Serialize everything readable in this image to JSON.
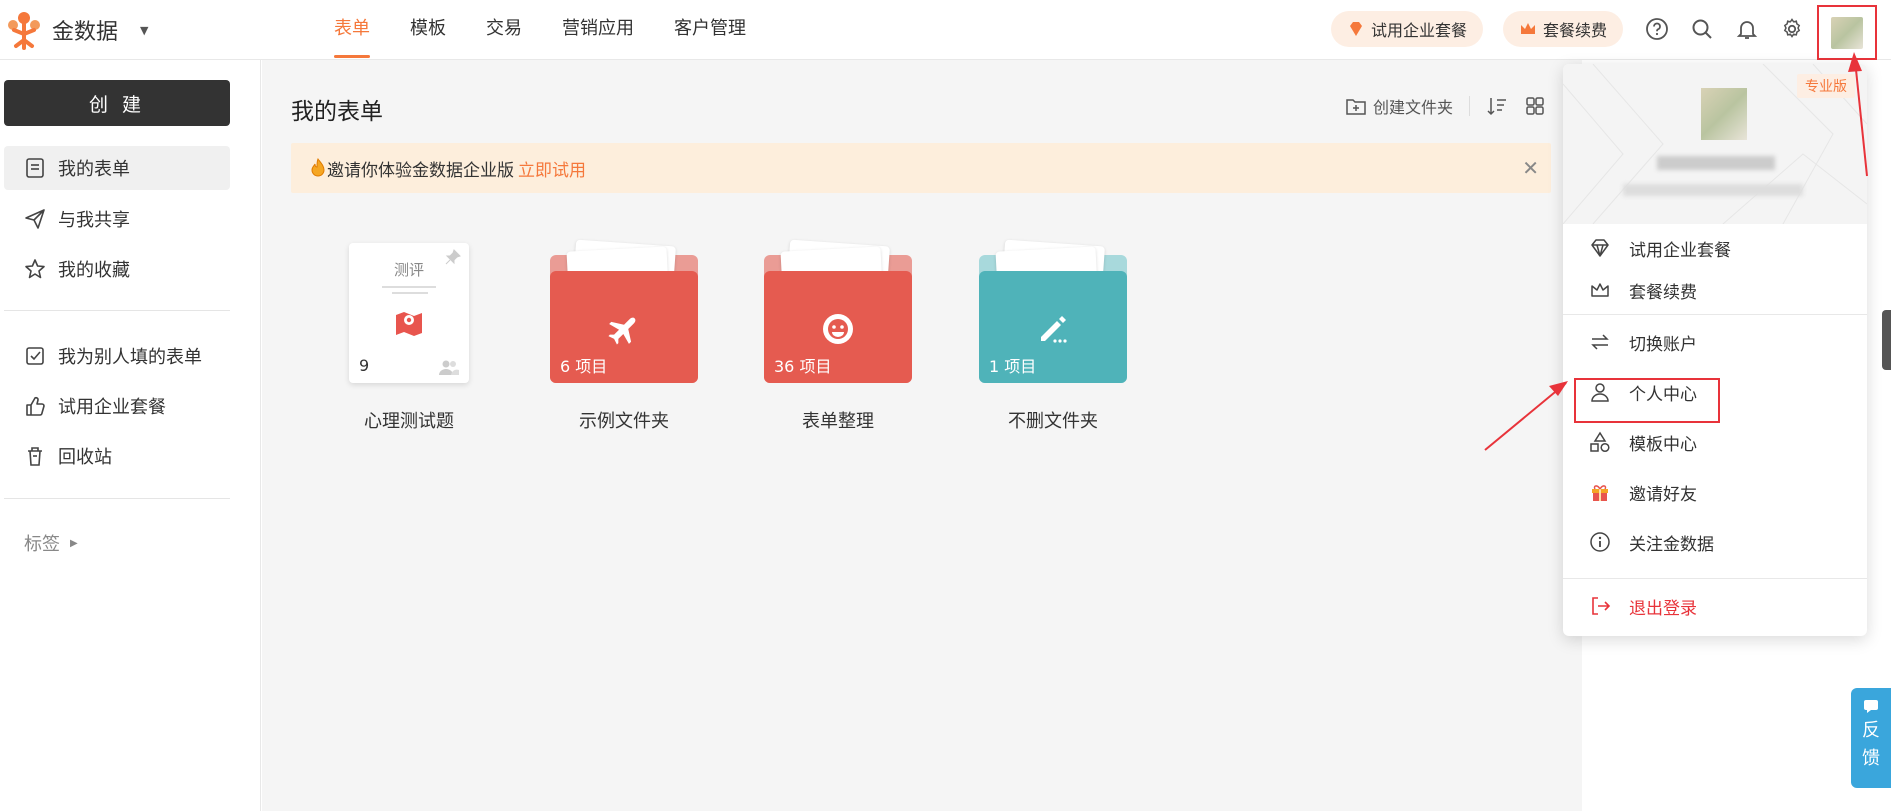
{
  "app": {
    "name": "金数据"
  },
  "nav": {
    "items": [
      "表单",
      "模板",
      "交易",
      "营销应用",
      "客户管理"
    ],
    "active": 0
  },
  "header": {
    "trial_label": "试用企业套餐",
    "renew_label": "套餐续费"
  },
  "sidebar": {
    "create_label": "创 建",
    "items": [
      "我的表单",
      "与我共享",
      "我的收藏",
      "我为别人填的表单",
      "试用企业套餐",
      "回收站"
    ],
    "tag_label": "标签"
  },
  "main": {
    "title": "我的表单",
    "new_folder_label": "创建文件夹",
    "banner_text": "邀请你体验金数据企业版",
    "banner_link": "立即试用",
    "form_card": {
      "title": "测评",
      "count": "9",
      "label": "心理测试题"
    },
    "folders": [
      {
        "count": "6 项目",
        "label": "示例文件夹",
        "color": "#e55b50",
        "icon": "plane-icon"
      },
      {
        "count": "36 项目",
        "label": "表单整理",
        "color": "#e55b50",
        "icon": "smile-icon"
      },
      {
        "count": "1 项目",
        "label": "不删文件夹",
        "color": "#4fb3b9",
        "icon": "pen-icon"
      }
    ]
  },
  "dropdown": {
    "badge": "专业版",
    "items": [
      "试用企业套餐",
      "套餐续费",
      "切换账户",
      "个人中心",
      "模板中心",
      "邀请好友",
      "关注金数据",
      "退出登录"
    ]
  },
  "feedback": {
    "label1": "反",
    "label2": "馈"
  },
  "colors": {
    "accent": "#f5783b",
    "danger": "#e8333a",
    "feedback": "#3aa6dc"
  }
}
